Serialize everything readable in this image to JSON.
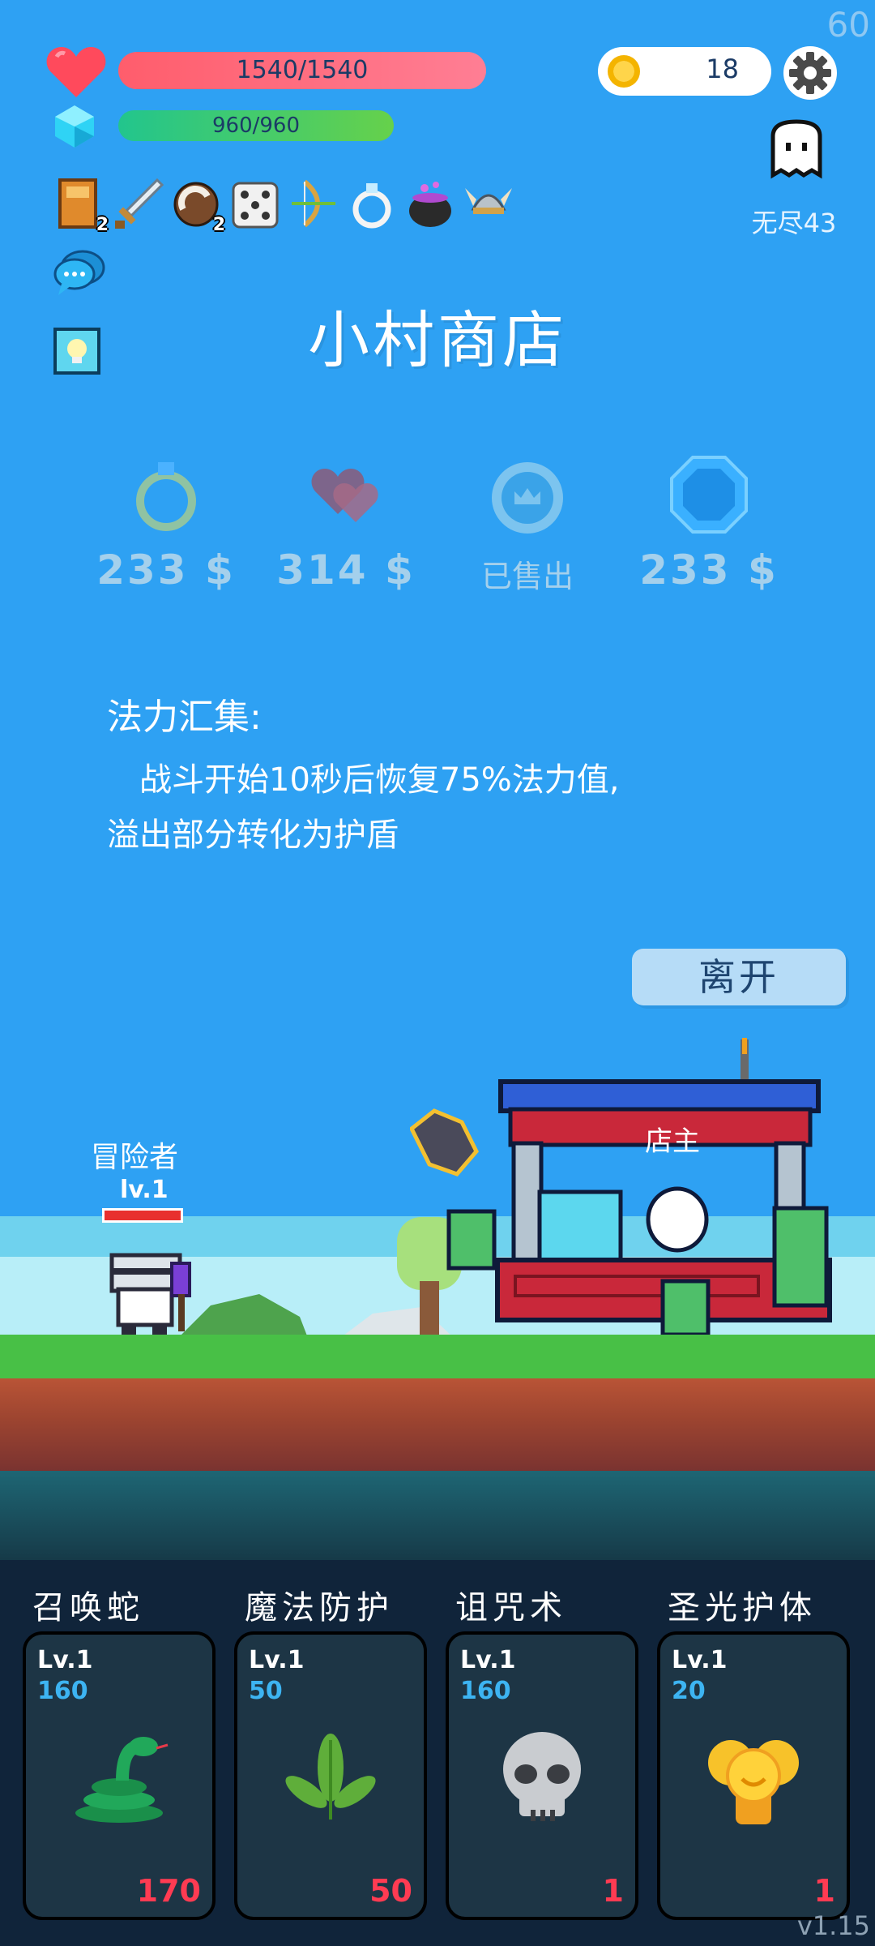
{
  "fps": "60",
  "hud": {
    "hp": "1540/1540",
    "mp": "960/960",
    "coins": "18",
    "mode": "无尽43"
  },
  "inventory": [
    {
      "name": "book-icon",
      "count": "2"
    },
    {
      "name": "sword-icon",
      "count": ""
    },
    {
      "name": "coconut-icon",
      "count": "2"
    },
    {
      "name": "dice-icon",
      "count": ""
    },
    {
      "name": "bow-icon",
      "count": ""
    },
    {
      "name": "ring-icon",
      "count": ""
    },
    {
      "name": "cauldron-icon",
      "count": ""
    },
    {
      "name": "viking-helmet-icon",
      "count": ""
    }
  ],
  "shop": {
    "title": "小村商店",
    "goods": [
      {
        "icon": "ring-icon",
        "price": "233 $"
      },
      {
        "icon": "hearts-icon",
        "price": "314 $"
      },
      {
        "icon": "crown-badge-icon",
        "price": "已售出"
      },
      {
        "icon": "sapphire-icon",
        "price": "233 $"
      }
    ],
    "description": {
      "title": "法力汇集:",
      "line1": "战斗开始10秒后恢复75%法力值,",
      "line2": "溢出部分转化为护盾"
    },
    "leave": "离开"
  },
  "scene": {
    "player_name": "冒险者",
    "player_level": "lv.1",
    "shopkeeper": "店主",
    "player_hp_fraction": 1.0
  },
  "skills": [
    {
      "name": "召唤蛇",
      "level": "Lv.1",
      "mana": "160",
      "cost": "170",
      "icon": "snake-icon"
    },
    {
      "name": "魔法防护",
      "level": "Lv.1",
      "mana": "50",
      "cost": "50",
      "icon": "leaf-icon"
    },
    {
      "name": "诅咒术",
      "level": "Lv.1",
      "mana": "160",
      "cost": "1",
      "icon": "skull-icon"
    },
    {
      "name": "圣光护体",
      "level": "Lv.1",
      "mana": "20",
      "cost": "1",
      "icon": "golden-orbs-icon"
    }
  ],
  "version": "v1.15",
  "colors": {
    "background": "#2ea1f3",
    "hp_bar": "#ff6b80",
    "mp_bar": "#44c96a",
    "cost": "#ff3b52",
    "mana": "#3db4f2"
  }
}
